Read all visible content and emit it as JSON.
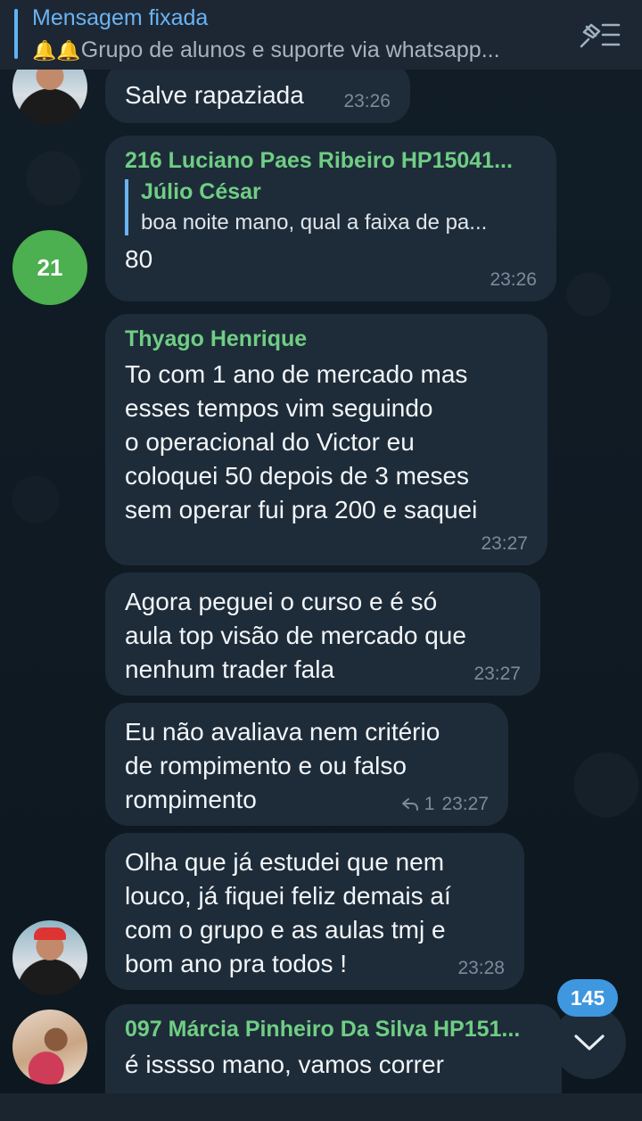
{
  "pinned": {
    "title": "Mensagem fixada",
    "bells": "🔔🔔",
    "text": "Grupo de alunos e suporte via whatsapp...",
    "icon": "pin-list-icon"
  },
  "messages": [
    {
      "body": "Salve rapaziada",
      "time": "23:26"
    },
    {
      "sender": "216 Luciano Paes Ribeiro HP15041...",
      "reply_name": "Júlio César",
      "reply_text": "boa noite mano, qual a faixa de pa...",
      "body": "80",
      "time": "23:26",
      "avatar_count": "21"
    },
    {
      "sender": "Thyago Henrique",
      "lines": [
        "To com 1 ano de mercado mas",
        "esses tempos vim seguindo",
        "o operacional do Victor eu",
        "coloquei 50 depois de 3 meses",
        "sem operar fui pra 200 e saquei"
      ],
      "time": "23:27"
    },
    {
      "lines": [
        "Agora peguei o curso e é só",
        "aula top visão de mercado que",
        "nenhum trader fala"
      ],
      "time": "23:27"
    },
    {
      "lines": [
        "Eu não avaliava nem critério",
        "de rompimento e ou falso",
        "rompimento"
      ],
      "reply_count": "1",
      "time": "23:27"
    },
    {
      "lines": [
        "Olha que já estudei que nem",
        "louco, já fiquei feliz demais aí",
        "com o grupo e as aulas tmj e",
        "bom ano pra todos !"
      ],
      "time": "23:28"
    },
    {
      "sender": "097 Márcia Pinheiro Da Silva HP151...",
      "body": "é isssso mano, vamos correr"
    }
  ],
  "unread_badge": "145",
  "colors": {
    "accent": "#6ab3f3",
    "sender": "#6fce83",
    "bubble": "#1e2c3a",
    "badge": "#3f97e0"
  }
}
